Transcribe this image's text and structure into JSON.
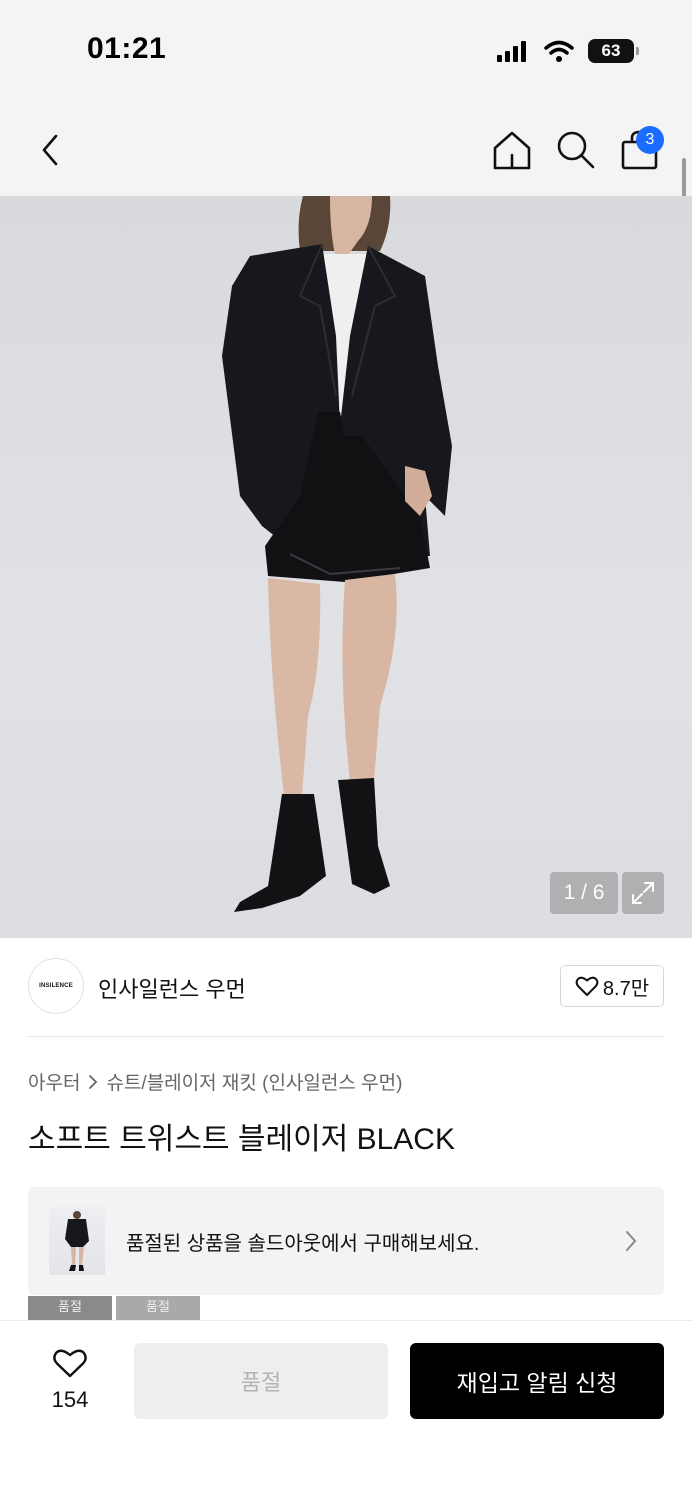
{
  "status_bar": {
    "time": "01:21",
    "battery": "63"
  },
  "nav": {
    "cart_count": "3"
  },
  "gallery": {
    "counter": "1 / 6"
  },
  "brand": {
    "logo_text": "INSILENCE",
    "name": "인사일런스 우먼",
    "like_count": "8.7만"
  },
  "breadcrumb": {
    "category": "아우터",
    "subcategory": "슈트/블레이저 재킷 (인사일런스 우먼)"
  },
  "product": {
    "title": "소프트 트위스트 블레이저 BLACK"
  },
  "soldout_banner": {
    "text": "품절된 상품을 솔드아웃에서 구매해보세요."
  },
  "swatches": [
    {
      "label": "품절"
    },
    {
      "label": "품절"
    }
  ],
  "bottom_bar": {
    "like_count": "154",
    "soldout_label": "품절",
    "restock_label": "재입고 알림 신청"
  },
  "colors": {
    "accent_blue": "#1a6dff",
    "primary_button": "#000000",
    "disabled_button": "#eeeeee"
  }
}
